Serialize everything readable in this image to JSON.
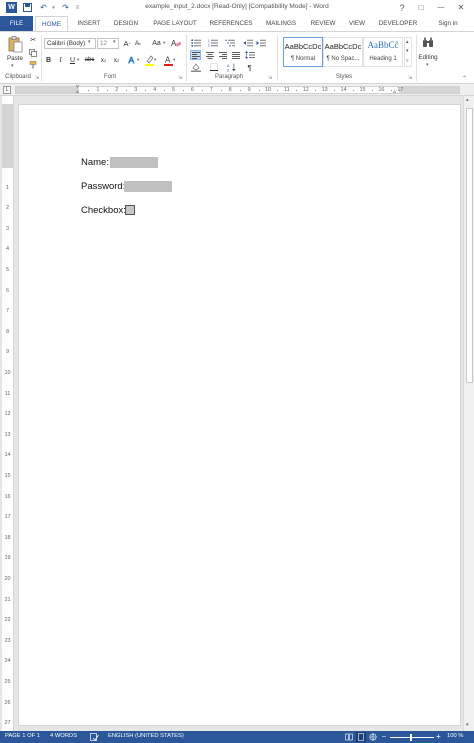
{
  "window": {
    "title": "example_input_2.docx [Read-Only] [Compatibility Mode] - Word",
    "help": "?",
    "restore": "□",
    "minimize": "—",
    "close": "✕",
    "sign_in": "Sign in"
  },
  "tabs": [
    "FILE",
    "HOME",
    "INSERT",
    "DESIGN",
    "PAGE LAYOUT",
    "REFERENCES",
    "MAILINGS",
    "REVIEW",
    "VIEW",
    "DEVELOPER"
  ],
  "ribbon": {
    "clipboard": {
      "paste_label": "Paste",
      "group_label": "Clipboard"
    },
    "font": {
      "font_name": "Calibri (Body)",
      "font_size": "12",
      "group_label": "Font"
    },
    "paragraph": {
      "group_label": "Paragraph"
    },
    "styles": {
      "group_label": "Styles",
      "items": [
        {
          "preview": "AaBbCcDc",
          "name": "¶ Normal"
        },
        {
          "preview": "AaBbCcDc",
          "name": "¶ No Spac..."
        },
        {
          "preview": "AaBbCĉ",
          "name": "Heading 1"
        }
      ]
    },
    "editing": {
      "label": "Editing"
    }
  },
  "ruler": {
    "numbers": [
      "1",
      "2",
      "3",
      "4",
      "5",
      "6",
      "7",
      "8",
      "9",
      "10",
      "11",
      "12",
      "13",
      "14",
      "15",
      "16",
      "17"
    ]
  },
  "vruler": {
    "numbers": [
      "1",
      "2",
      "3",
      "4",
      "5",
      "6",
      "7",
      "8",
      "9",
      "10",
      "11",
      "12",
      "13",
      "14",
      "15",
      "16",
      "17",
      "18",
      "19",
      "20",
      "21",
      "22",
      "23",
      "24",
      "25",
      "26",
      "27"
    ]
  },
  "document": {
    "name_label": "Name:",
    "password_label": "Password:",
    "checkbox_label": "Checkbox:"
  },
  "statusbar": {
    "page": "PAGE 1 OF 1",
    "words": "4 WORDS",
    "language": "ENGLISH (UNITED STATES)",
    "zoom": "100 %"
  },
  "colors": {
    "accent": "#2b579a",
    "field_gray": "#c0c0c0"
  }
}
